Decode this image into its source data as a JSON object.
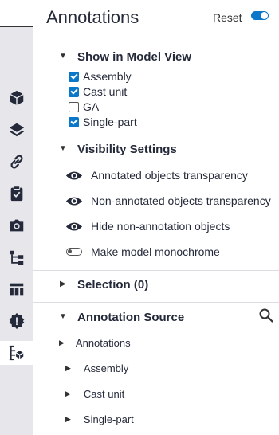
{
  "rail": {
    "icons": [
      "cube-icon",
      "layers-icon",
      "link-icon",
      "clipboard-check-icon",
      "camera-icon",
      "hierarchy-icon",
      "table-icon",
      "alert-gear-icon",
      "annotation-tree-icon"
    ]
  },
  "header": {
    "title": "Annotations",
    "reset_label": "Reset",
    "toggle_on": true
  },
  "show_in_model_view": {
    "title": "Show in Model View",
    "items": [
      {
        "label": "Assembly",
        "checked": true
      },
      {
        "label": "Cast unit",
        "checked": true
      },
      {
        "label": "GA",
        "checked": false
      },
      {
        "label": "Single-part",
        "checked": true
      }
    ]
  },
  "visibility_settings": {
    "title": "Visibility Settings",
    "items": [
      {
        "label": "Annotated objects transparency",
        "icon": "eye-icon"
      },
      {
        "label": "Non-annotated objects transparency",
        "icon": "eye-icon"
      },
      {
        "label": "Hide non-annotation objects",
        "icon": "eye-icon"
      },
      {
        "label": "Make model monochrome",
        "icon": "toggle-icon"
      }
    ]
  },
  "selection": {
    "title": "Selection (0)"
  },
  "annotation_source": {
    "title": "Annotation Source",
    "root": "Annotations",
    "children": [
      "Assembly",
      "Cast unit",
      "Single-part"
    ]
  },
  "colors": {
    "accent": "#0a77c9",
    "text": "#252a3a",
    "rail": "#e6e6eb"
  }
}
